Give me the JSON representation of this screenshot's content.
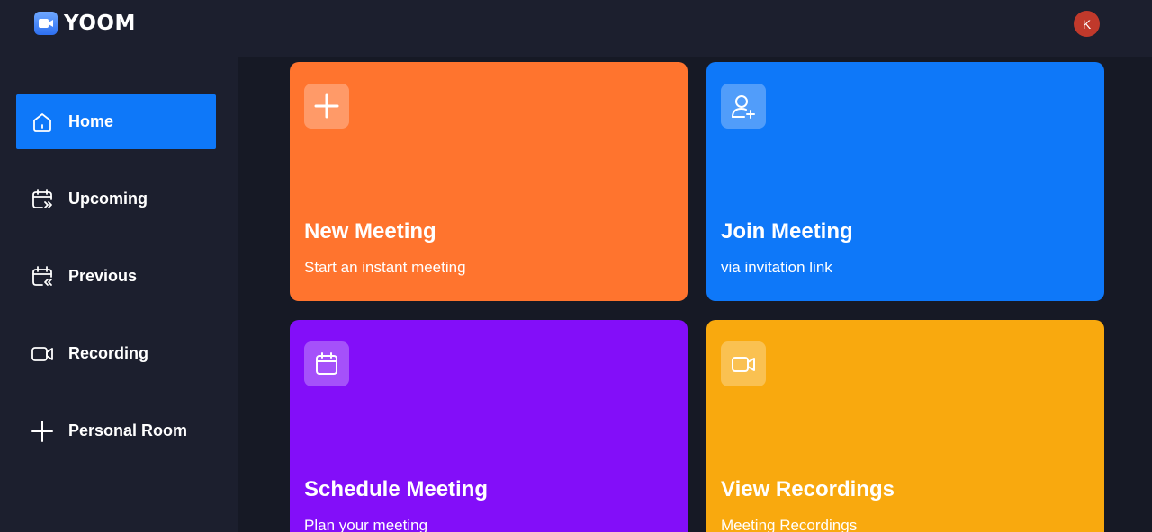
{
  "app": {
    "name": "YOOM",
    "avatar_initial": "K"
  },
  "sidebar": {
    "items": [
      {
        "label": "Home",
        "icon": "home-icon",
        "active": true
      },
      {
        "label": "Upcoming",
        "icon": "calendar-forward-icon",
        "active": false
      },
      {
        "label": "Previous",
        "icon": "calendar-back-icon",
        "active": false
      },
      {
        "label": "Recording",
        "icon": "video-icon",
        "active": false
      },
      {
        "label": "Personal Room",
        "icon": "plus-icon",
        "active": false
      }
    ]
  },
  "cards": [
    {
      "title": "New Meeting",
      "subtitle": "Start an instant meeting",
      "icon": "plus-icon",
      "color": "#ff742e"
    },
    {
      "title": "Join Meeting",
      "subtitle": "via invitation link",
      "icon": "user-plus-icon",
      "color": "#0e78f9"
    },
    {
      "title": "Schedule Meeting",
      "subtitle": "Plan your meeting",
      "icon": "calendar-icon",
      "color": "#830ef9"
    },
    {
      "title": "View Recordings",
      "subtitle": "Meeting Recordings",
      "icon": "video-icon",
      "color": "#f9a90e"
    }
  ],
  "colors": {
    "background": "#161925",
    "panel": "#1c1f2e",
    "accent": "#0e78f9",
    "avatar": "#c0392b"
  }
}
